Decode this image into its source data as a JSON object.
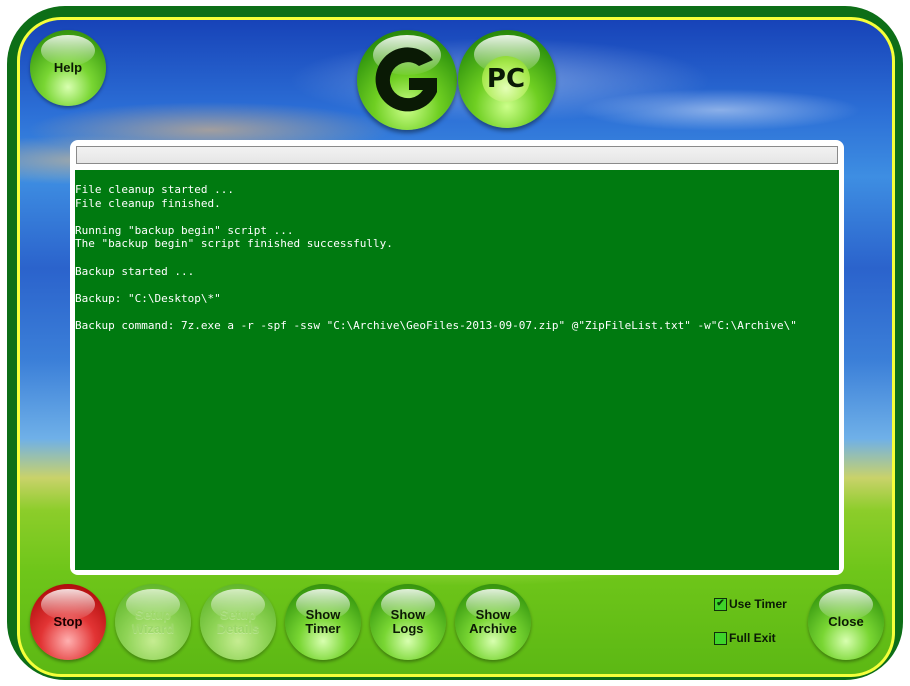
{
  "logo": {
    "g_letter": "G",
    "pc_label": "PC"
  },
  "buttons": {
    "help": "Help",
    "stop": "Stop",
    "setup_wizard": "Setup\nWizard",
    "setup_details": "Setup\nDetails",
    "show_timer": "Show\nTimer",
    "show_logs": "Show\nLogs",
    "show_archive": "Show\nArchive",
    "close": "Close"
  },
  "progress": {
    "value": 0
  },
  "console": {
    "lines": [
      "File cleanup started ...",
      "File cleanup finished.",
      "",
      "Running \"backup begin\" script ...",
      "The \"backup begin\" script finished successfully.",
      "",
      "Backup started ...",
      "",
      "Backup: \"C:\\Desktop\\*\"",
      "",
      "Backup command: 7z.exe a -r -spf -ssw \"C:\\Archive\\GeoFiles-2013-09-07.zip\" @\"ZipFileList.txt\" -w\"C:\\Archive\\\""
    ]
  },
  "options": {
    "use_timer": {
      "label": "Use Timer",
      "checked": true
    },
    "full_exit": {
      "label": "Full Exit",
      "checked": false
    }
  },
  "colors": {
    "frame": "#0d6e17",
    "frame_border": "#f5ff3a",
    "console_bg": "#007a10",
    "stop_button": "#e23434",
    "button_green": "#79d633"
  }
}
